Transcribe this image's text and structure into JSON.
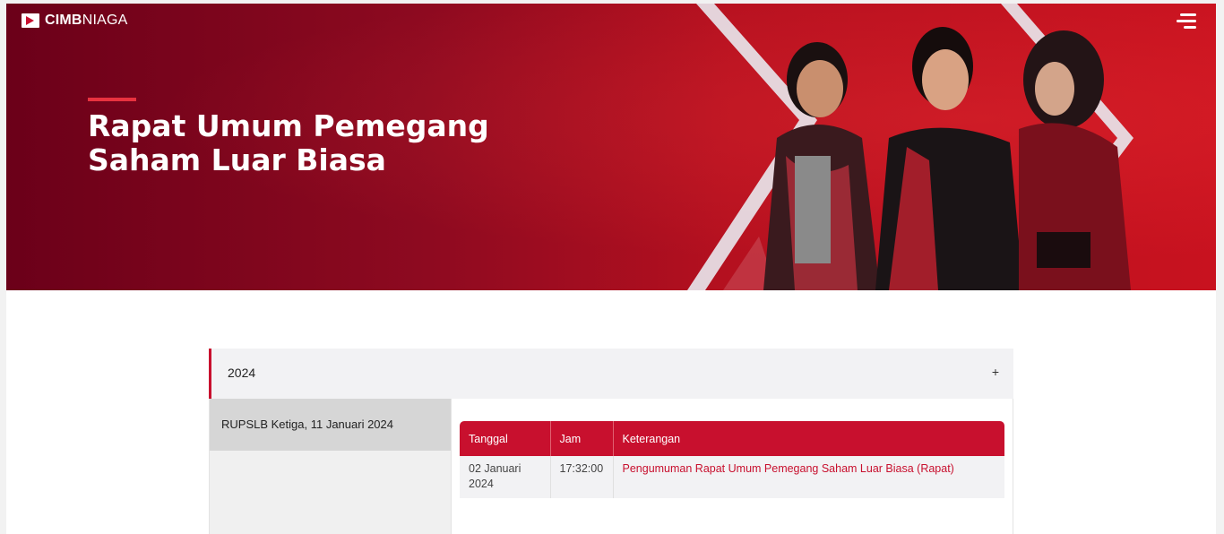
{
  "brand": {
    "logo_bold": "CIMB",
    "logo_light": "NIAGA"
  },
  "hero": {
    "title": "Rapat Umum Pemegang Saham Luar Biasa"
  },
  "accordion": {
    "year": "2024",
    "toggle_symbol": "+",
    "sidebar_items": [
      {
        "label": "RUPSLB Ketiga, 11 Januari  2024"
      }
    ],
    "table": {
      "headers": [
        "Tanggal",
        "Jam",
        "Keterangan"
      ],
      "rows": [
        {
          "tanggal": "02 Januari 2024",
          "jam": "17:32:00",
          "keterangan": "Pengumuman Rapat Umum Pemegang Saham Luar Biasa (Rapat)"
        }
      ]
    }
  },
  "colors": {
    "brand_red": "#c8102e",
    "hero_dark": "#6b0019",
    "accent_bar": "#e8323f"
  },
  "icons": {
    "menu": "hamburger-menu-icon",
    "logo": "cimb-logo-icon"
  }
}
